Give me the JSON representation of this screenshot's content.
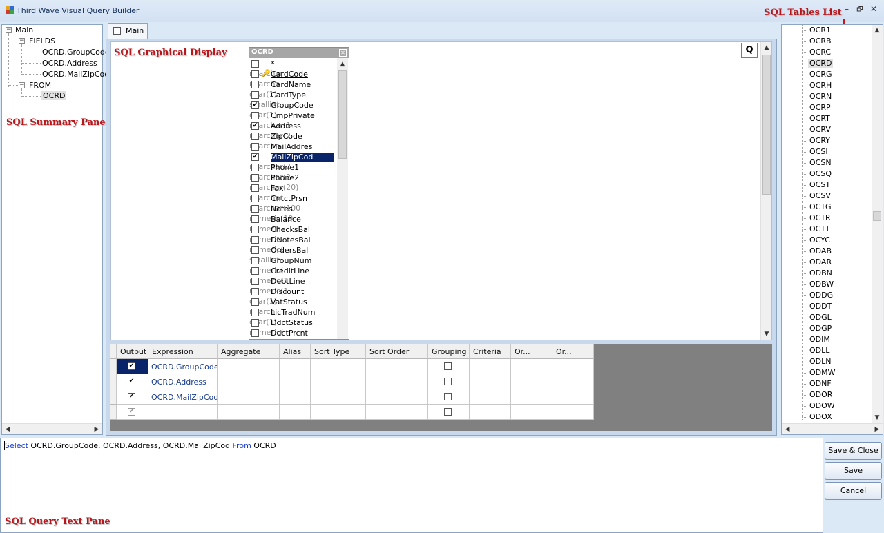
{
  "window": {
    "title": "Third Wave Visual Query Builder",
    "minimize": "–",
    "restore": "🗗",
    "close": "✕"
  },
  "labels": {
    "summary_pane": "SQL Summary Pane",
    "graphical_display": "SQL Graphical Display",
    "tables_list": "SQL Tables List",
    "query_text_pane": "SQL Query Text Pane"
  },
  "summary_tree": {
    "root": "Main",
    "fields_label": "FIELDS",
    "fields": [
      "OCRD.GroupCode",
      "OCRD.Address",
      "OCRD.MailZipCod"
    ],
    "from_label": "FROM",
    "from": [
      "OCRD"
    ]
  },
  "tabs": [
    {
      "label": "Main"
    }
  ],
  "graphic": {
    "q_button": "Q"
  },
  "table_window": {
    "title": "OCRD",
    "close": "✕",
    "columns": [
      {
        "name": "*",
        "type": "",
        "checked": false,
        "key": false
      },
      {
        "name": "CardCode",
        "type": "nvarchar",
        "checked": false,
        "key": true
      },
      {
        "name": "CardName",
        "type": "nvarcha",
        "checked": false,
        "key": false
      },
      {
        "name": "CardType",
        "type": "char(1)",
        "checked": false,
        "key": false
      },
      {
        "name": "GroupCode",
        "type": "smallint",
        "checked": true,
        "key": false
      },
      {
        "name": "CmpPrivate",
        "type": "char(1)",
        "checked": false,
        "key": false
      },
      {
        "name": "Address",
        "type": "nvarchar(1",
        "checked": true,
        "key": false
      },
      {
        "name": "ZipCode",
        "type": "nvarchar(2",
        "checked": false,
        "key": false
      },
      {
        "name": "MailAddres",
        "type": "nvarcha",
        "checked": false,
        "key": false
      },
      {
        "name": "MailZipCod",
        "type": "nvarcha",
        "checked": true,
        "key": false
      },
      {
        "name": "Phone1",
        "type": "nvarchar(2",
        "checked": false,
        "key": false
      },
      {
        "name": "Phone2",
        "type": "nvarchar(2",
        "checked": false,
        "key": false
      },
      {
        "name": "Fax",
        "type": "nvarchar(20)",
        "checked": false,
        "key": false
      },
      {
        "name": "CntctPrsn",
        "type": "nvarchar",
        "checked": false,
        "key": false
      },
      {
        "name": "Notes",
        "type": "nvarchar(100",
        "checked": false,
        "key": false
      },
      {
        "name": "Balance",
        "type": "numeric(19",
        "checked": false,
        "key": false
      },
      {
        "name": "ChecksBal",
        "type": "numeric",
        "checked": false,
        "key": false
      },
      {
        "name": "DNotesBal",
        "type": "numeric",
        "checked": false,
        "key": false
      },
      {
        "name": "OrdersBal",
        "type": "numeric(",
        "checked": false,
        "key": false
      },
      {
        "name": "GroupNum",
        "type": "smallint",
        "checked": false,
        "key": false
      },
      {
        "name": "CreditLine",
        "type": "numeric(",
        "checked": false,
        "key": false
      },
      {
        "name": "DebtLine",
        "type": "numeric(1",
        "checked": false,
        "key": false
      },
      {
        "name": "Discount",
        "type": "numeric(1",
        "checked": false,
        "key": false
      },
      {
        "name": "VatStatus",
        "type": "char(1)",
        "checked": false,
        "key": false
      },
      {
        "name": "LicTradNum",
        "type": "nvarch",
        "checked": false,
        "key": false
      },
      {
        "name": "DdctStatus",
        "type": "char(1)",
        "checked": false,
        "key": false
      },
      {
        "name": "DdctPrcnt",
        "type": "numeric(",
        "checked": false,
        "key": false
      }
    ]
  },
  "grid": {
    "headers": [
      "Output",
      "Expression",
      "Aggregate",
      "Alias",
      "Sort Type",
      "Sort Order",
      "Grouping",
      "Criteria",
      "Or...",
      "Or..."
    ],
    "rows": [
      {
        "output": true,
        "expression": "OCRD.GroupCode",
        "grouping": false
      },
      {
        "output": true,
        "expression": "OCRD.Address",
        "grouping": false
      },
      {
        "output": true,
        "expression": "OCRD.MailZipCod",
        "grouping": false
      },
      {
        "output": true,
        "expression": "",
        "grouping": false
      }
    ]
  },
  "tables_list": {
    "items": [
      "OCR1",
      "OCRB",
      "OCRC",
      "OCRD",
      "OCRG",
      "OCRH",
      "OCRN",
      "OCRP",
      "OCRT",
      "OCRV",
      "OCRY",
      "OCSI",
      "OCSN",
      "OCSQ",
      "OCST",
      "OCSV",
      "OCTG",
      "OCTR",
      "OCTT",
      "OCYC",
      "ODAB",
      "ODAR",
      "ODBN",
      "ODBW",
      "ODDG",
      "ODDT",
      "ODGL",
      "ODGP",
      "ODIM",
      "ODLL",
      "ODLN",
      "ODMW",
      "ODNF",
      "ODOR",
      "ODOW",
      "ODOX"
    ],
    "selected": "OCRD"
  },
  "query": {
    "kw_select": "Select",
    "fields_text": " OCRD.GroupCode, OCRD.Address, OCRD.MailZipCod ",
    "kw_from": "From",
    "table_text": " OCRD"
  },
  "buttons": {
    "save_close": "Save & Close",
    "save": "Save",
    "cancel": "Cancel"
  },
  "colors": {
    "label_red": "#b8161b",
    "selection": "#0a246a",
    "keyword_blue": "#1a3cc8",
    "expression_blue": "#1a3c8c"
  }
}
